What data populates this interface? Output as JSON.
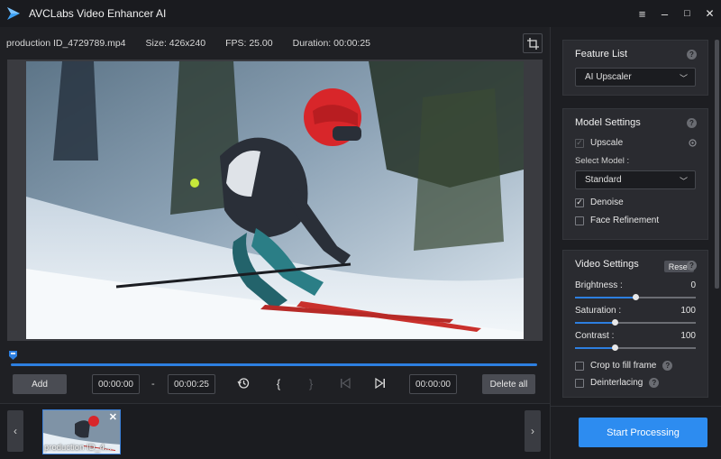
{
  "app": {
    "title": "AVCLabs Video Enhancer AI"
  },
  "window_controls": {
    "menu": "≡",
    "minimize": "–",
    "maximize": "□",
    "close": "✕"
  },
  "info": {
    "filename": "production ID_4729789.mp4",
    "size": "Size: 426x240",
    "fps": "FPS: 25.00",
    "duration": "Duration: 00:00:25"
  },
  "controls": {
    "add_label": "Add",
    "start_time": "00:00:00",
    "separator": "-",
    "end_time": "00:00:25",
    "mark_in": "{",
    "mark_out": "}",
    "current_time": "00:00:00",
    "delete_all_label": "Delete all"
  },
  "timeline": {
    "progress": 1.0
  },
  "strip": {
    "prev": "‹",
    "next": "›",
    "thumb_label": "production ID_4...",
    "thumb_close": "✕"
  },
  "feature_list": {
    "title": "Feature List",
    "selected": "AI Upscaler"
  },
  "model_settings": {
    "title": "Model Settings",
    "upscale_label": "Upscale",
    "upscale_checked": true,
    "select_model_label": "Select Model :",
    "model_selected": "Standard",
    "denoise_label": "Denoise",
    "denoise_checked": true,
    "face_refinement_label": "Face Refinement",
    "face_refinement_checked": false
  },
  "video_settings": {
    "title": "Video Settings",
    "reset_label": "Reset",
    "brightness": {
      "label": "Brightness :",
      "value": "0",
      "fraction": 0.5
    },
    "saturation": {
      "label": "Saturation :",
      "value": "100",
      "fraction": 0.33
    },
    "contrast": {
      "label": "Contrast :",
      "value": "100",
      "fraction": 0.33
    },
    "crop_label": "Crop to fill frame",
    "crop_checked": false,
    "deinterlacing_label": "Deinterlacing",
    "deinterlacing_checked": false
  },
  "help_glyph": "?",
  "check_glyph": "✓",
  "start_label": "Start Processing",
  "colors": {
    "accent": "#2d8cf0",
    "timeline": "#2d7fe0"
  }
}
